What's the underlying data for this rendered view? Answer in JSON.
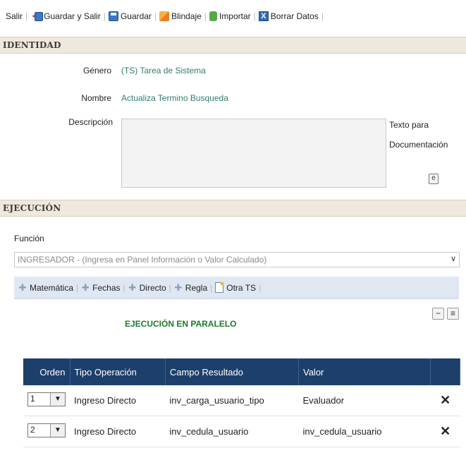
{
  "toolbar": {
    "exit_label": "Salir",
    "save_exit_label": "Guardar y Salir",
    "save_label": "Guardar",
    "shield_label": "Blindaje",
    "import_label": "Importar",
    "clear_label": "Borrar Datos"
  },
  "identity": {
    "section_title": "IDENTIDAD",
    "genre_label": "Género",
    "genre_value": "(TS) Tarea de Sistema",
    "name_label": "Nombre",
    "name_value": "Actualiza Termino Busqueda",
    "description_label": "Descripción",
    "description_value": "",
    "doc_text_line1": "Texto para",
    "doc_text_line2": "Documentación",
    "doc_button": "e"
  },
  "execution": {
    "section_title": "EJECUCIÓN",
    "function_label": "Función",
    "function_value": "INGRESADOR - (Ingresa en Panel Información o Valor Calculado)",
    "subtoolbar": {
      "math": "Matemática",
      "dates": "Fechas",
      "direct": "Directo",
      "rule": "Regla",
      "other_ts": "Otra TS"
    },
    "parallel_title": "EJECUCIÓN EN PARALELO",
    "controls": {
      "minus": "−",
      "menu": "≡"
    },
    "table": {
      "headers": [
        "Orden",
        "Tipo Operación",
        "Campo Resultado",
        "Valor"
      ],
      "rows": [
        {
          "order": "1",
          "type": "Ingreso Directo",
          "field": "inv_carga_usuario_tipo",
          "value": "Evaluador"
        },
        {
          "order": "2",
          "type": "Ingreso Directo",
          "field": "inv_cedula_usuario",
          "value": "inv_cedula_usuario"
        }
      ]
    }
  },
  "colors": {
    "header_bg": "#1d3f6b",
    "section_bg": "#efe8dd",
    "value_text": "#2e7d6e",
    "parallel_title": "#1e7a2e",
    "delete_icon": "#c0181e"
  }
}
